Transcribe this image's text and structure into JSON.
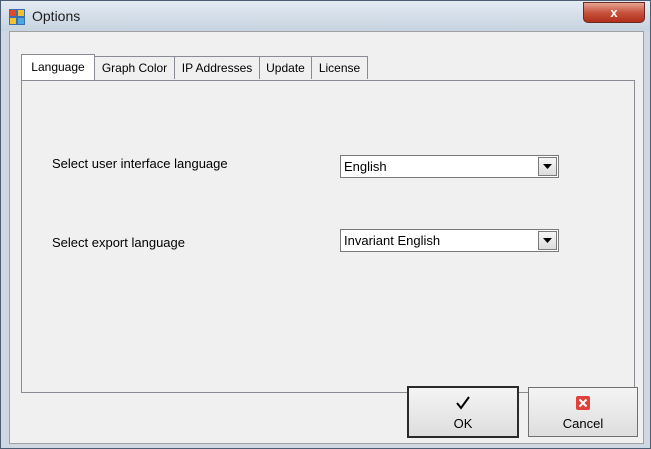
{
  "window": {
    "title": "Options",
    "close_label": "x"
  },
  "tabs": [
    {
      "label": "Language",
      "active": true
    },
    {
      "label": "Graph Color",
      "active": false
    },
    {
      "label": "IP Addresses",
      "active": false
    },
    {
      "label": "Update",
      "active": false
    },
    {
      "label": "License",
      "active": false
    }
  ],
  "language": {
    "ui_label": "Select user interface language",
    "ui_value": "English",
    "export_label": "Select export language",
    "export_value": "Invariant English"
  },
  "buttons": {
    "ok_label": "OK",
    "cancel_label": "Cancel"
  },
  "colors": {
    "cancel_icon": "#e0413a",
    "title_bar": "#c6d3e0"
  }
}
